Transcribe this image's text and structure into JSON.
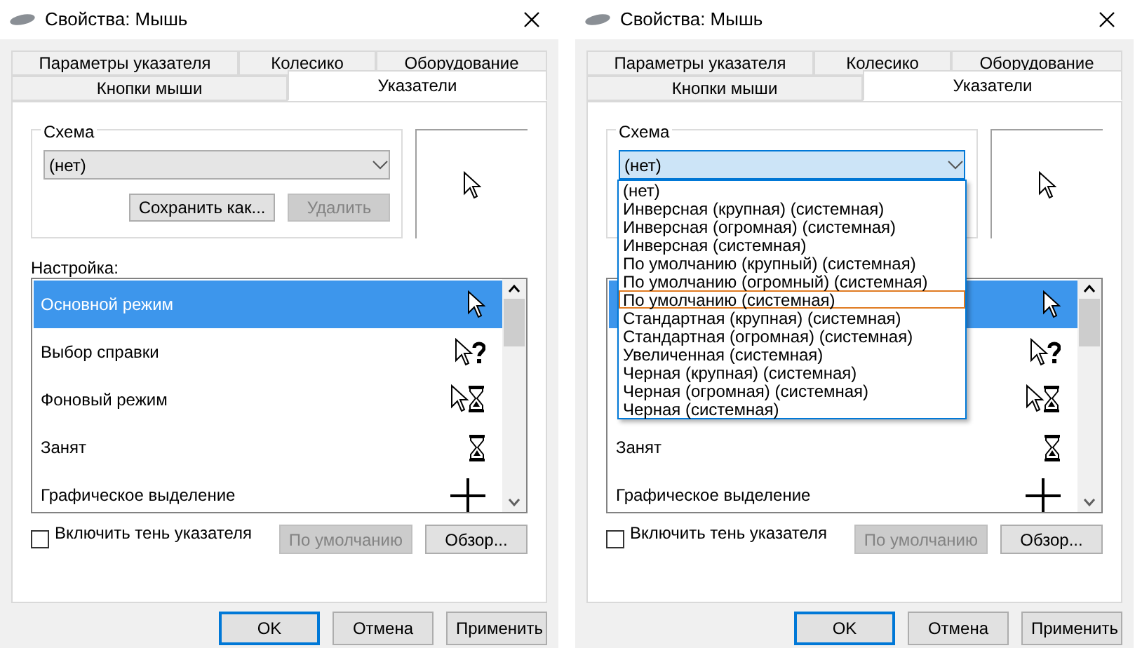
{
  "dialogs": [
    {
      "title": "Свойства: Мышь",
      "tabs_row1": [
        {
          "label": "Параметры указателя",
          "selected": false
        },
        {
          "label": "Колесико",
          "selected": false
        },
        {
          "label": "Оборудование",
          "selected": false
        }
      ],
      "tabs_row2": [
        {
          "label": "Кнопки мыши",
          "selected": false
        },
        {
          "label": "Указатели",
          "selected": true
        }
      ],
      "scheme": {
        "legend": "Схема",
        "value": "(нет)",
        "focused": false,
        "buttons": [
          {
            "label": "Сохранить как...",
            "disabled": false
          },
          {
            "label": "Удалить",
            "disabled": true
          }
        ]
      },
      "settings_label": "Настройка:",
      "cursors": [
        {
          "label": "Основной режим",
          "kind": "arrow",
          "selected": true
        },
        {
          "label": "Выбор справки",
          "kind": "help",
          "selected": false
        },
        {
          "label": "Фоновый режим",
          "kind": "working",
          "selected": false
        },
        {
          "label": "Занят",
          "kind": "busy",
          "selected": false
        },
        {
          "label": "Графическое выделение",
          "kind": "crosshair",
          "selected": false
        }
      ],
      "shadow": {
        "label": "Включить тень указателя",
        "checked": false
      },
      "list_buttons": [
        {
          "label": "По умолчанию",
          "disabled": true
        },
        {
          "label": "Обзор...",
          "disabled": false
        }
      ],
      "footer_buttons": [
        {
          "label": "OK",
          "default": true
        },
        {
          "label": "Отмена",
          "default": false
        },
        {
          "label": "Применить",
          "default": false
        }
      ]
    },
    {
      "title": "Свойства: Мышь",
      "tabs_row1": [
        {
          "label": "Параметры указателя",
          "selected": false
        },
        {
          "label": "Колесико",
          "selected": false
        },
        {
          "label": "Оборудование",
          "selected": false
        }
      ],
      "tabs_row2": [
        {
          "label": "Кнопки мыши",
          "selected": false
        },
        {
          "label": "Указатели",
          "selected": true
        }
      ],
      "scheme": {
        "legend": "Схема",
        "value": "(нет)",
        "focused": true
      },
      "dropdown": {
        "options": [
          {
            "label": "(нет)",
            "selected": false
          },
          {
            "label": "Инверсная (крупная) (системная)",
            "selected": false
          },
          {
            "label": "Инверсная (огромная) (системная)",
            "selected": false
          },
          {
            "label": "Инверсная (системная)",
            "selected": false
          },
          {
            "label": "По умолчанию (крупный) (системная)",
            "selected": false
          },
          {
            "label": "По умолчанию (огромный) (системная)",
            "selected": false
          },
          {
            "label": "По умолчанию (системная)",
            "selected": true
          },
          {
            "label": "Стандартная (крупная) (системная)",
            "selected": false
          },
          {
            "label": "Стандартная (огромная) (системная)",
            "selected": false
          },
          {
            "label": "Увеличенная (системная)",
            "selected": false
          },
          {
            "label": "Черная (крупная) (системная)",
            "selected": false
          },
          {
            "label": "Черная (огромная) (системная)",
            "selected": false
          },
          {
            "label": "Черная (системная)",
            "selected": false
          }
        ]
      },
      "cursors": [
        {
          "kind": "arrow",
          "selected": true
        },
        {
          "kind": "help",
          "selected": false
        },
        {
          "kind": "working",
          "selected": false
        },
        {
          "label": "Занят",
          "kind": "busy",
          "selected": false
        },
        {
          "label": "Графическое выделение",
          "kind": "crosshair",
          "selected": false
        }
      ],
      "shadow": {
        "label": "Включить тень указателя",
        "checked": false
      },
      "list_buttons": [
        {
          "label": "По умолчанию",
          "disabled": true
        },
        {
          "label": "Обзор...",
          "disabled": false
        }
      ],
      "footer_buttons": [
        {
          "label": "OK",
          "default": true
        },
        {
          "label": "Отмена",
          "default": false
        },
        {
          "label": "Применить",
          "default": false
        }
      ]
    }
  ]
}
